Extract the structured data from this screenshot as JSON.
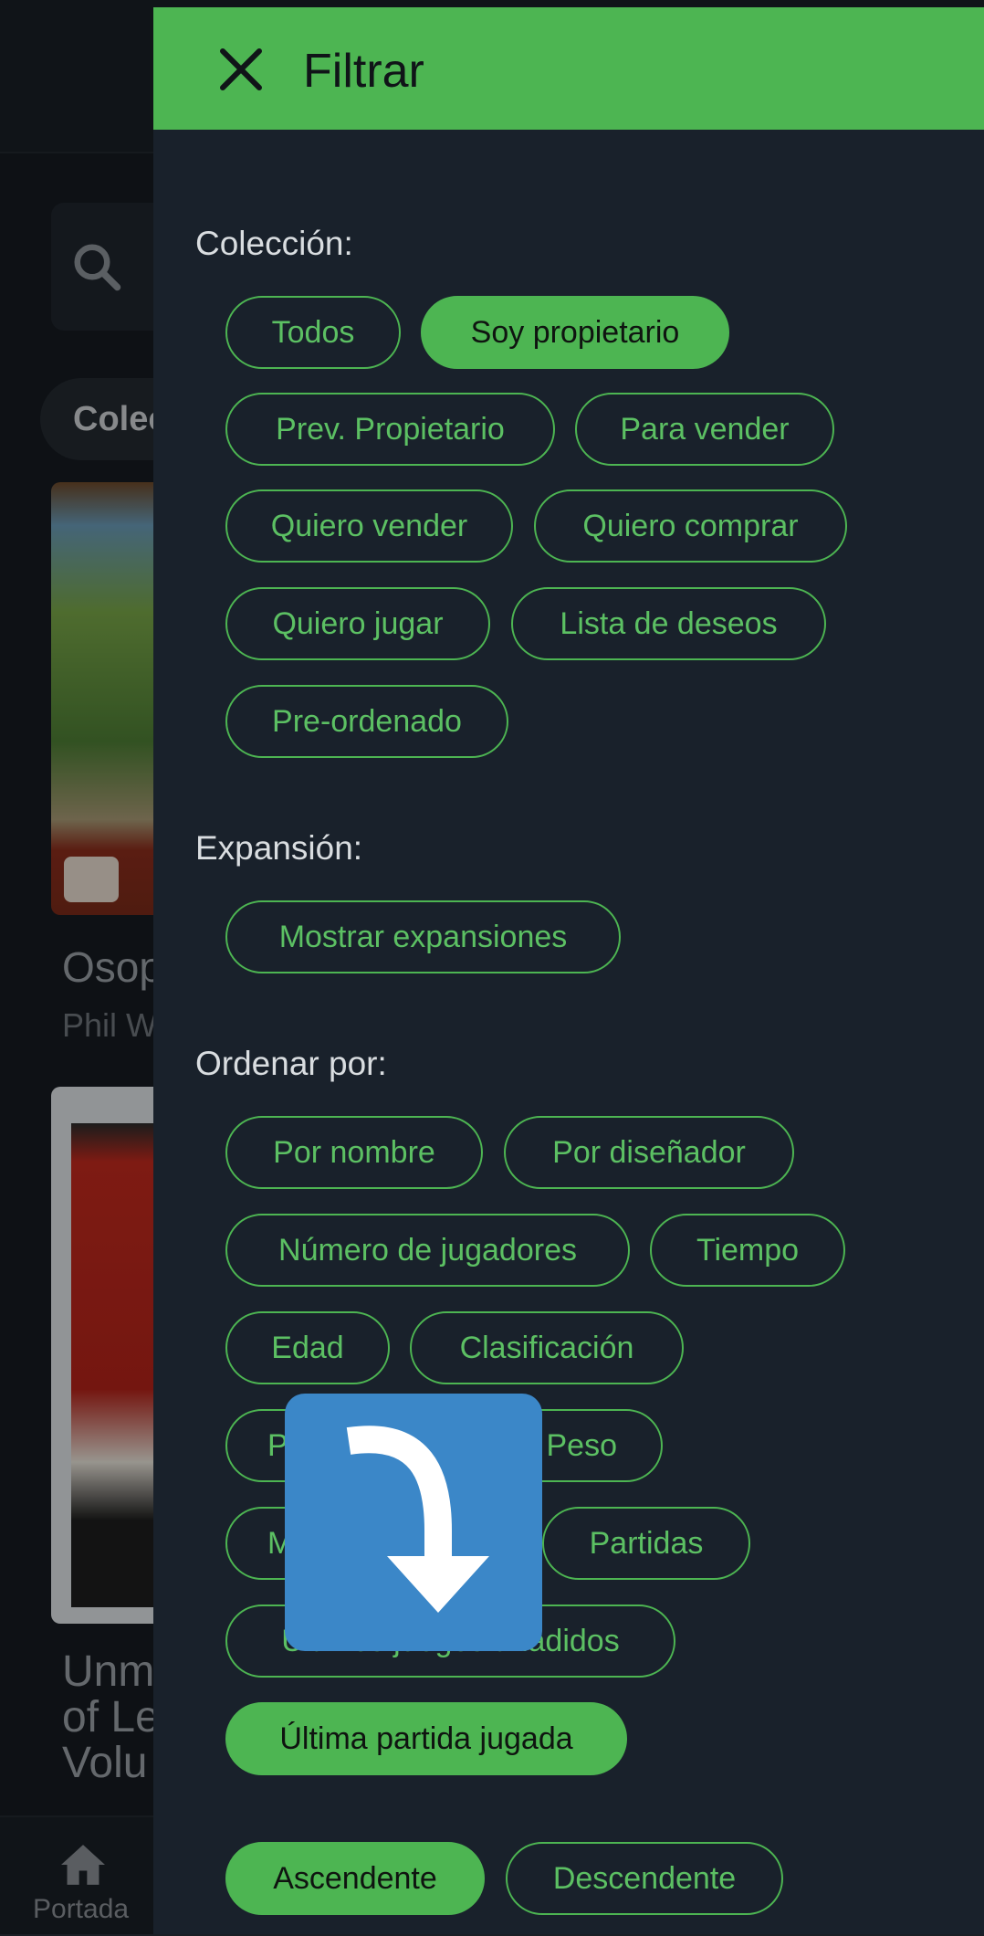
{
  "background": {
    "collection_chip": "Colec",
    "game1": {
      "title": "Osop",
      "author": "Phil W"
    },
    "game2": {
      "title": "Unm\nof Le\nVolu"
    },
    "bottom_nav": {
      "home_label": "Portada"
    }
  },
  "drawer": {
    "title": "Filtrar",
    "collection": {
      "label": "Colección:",
      "options": [
        "Todos",
        "Soy propietario",
        "Prev. Propietario",
        "Para vender",
        "Quiero vender",
        "Quiero comprar",
        "Quiero jugar",
        "Lista de deseos",
        "Pre-ordenado"
      ],
      "selected": "Soy propietario"
    },
    "expansion": {
      "label": "Expansión:",
      "options": [
        "Mostrar expansiones"
      ]
    },
    "sort": {
      "label": "Ordenar por:",
      "options": [
        "Por nombre",
        "Por diseñador",
        "Número de jugadores",
        "Tiempo",
        "Edad",
        "Clasificación",
        "P",
        "Peso",
        "M",
        "Partidas",
        "Últimos juegos añadidos",
        "Última partida jugada"
      ],
      "selected": "Última partida jugada"
    },
    "order": {
      "options": [
        "Ascendente",
        "Descendente"
      ],
      "selected": "Ascendente"
    }
  },
  "overlay": {
    "icon": "redo-arrow-icon",
    "color": "#3b87c8"
  },
  "colors": {
    "accent": "#4db552",
    "drawer_bg": "#19212b"
  }
}
